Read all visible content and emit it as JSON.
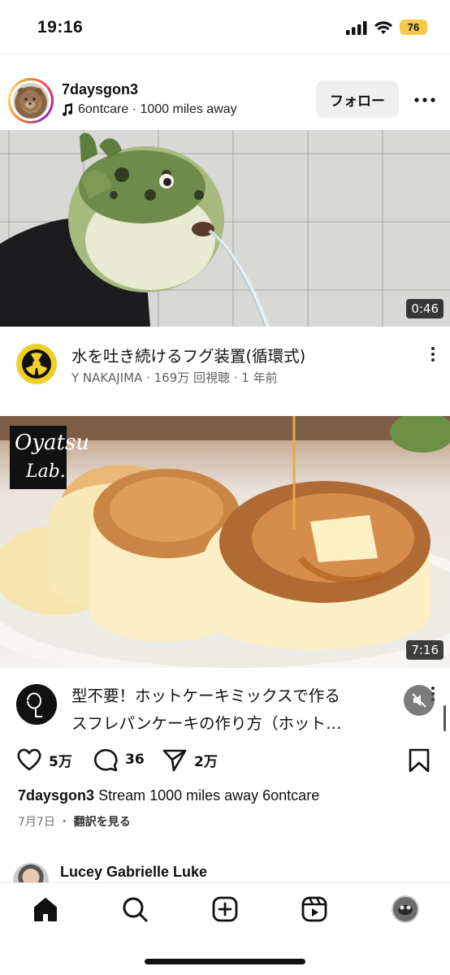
{
  "status_bar": {
    "time": "19:16",
    "battery": "76"
  },
  "post": {
    "username": "7daysgon3",
    "subtitle": "6ontcare · 1000 miles away",
    "follow_label": "フォロー",
    "more_label": "•••"
  },
  "videos": [
    {
      "duration": "0:46",
      "title": "水を吐き続けるフグ装置(循環式)",
      "meta": "Y NAKAJIMA · 169万 回視聴 · 1 年前"
    },
    {
      "duration": "7:16",
      "title_line1": "型不要！ホットケーキミックスで作る",
      "title_line2": "スフレパンケーキの作り方（ホット…",
      "logo_text_line1": "Oyatsu",
      "logo_text_line2": "Lab."
    }
  ],
  "actions": {
    "likes": "5万",
    "comments": "36",
    "shares": "2万"
  },
  "caption": {
    "username": "7daysgon3",
    "text": "Stream 1000 miles away 6ontcare"
  },
  "date_line": {
    "date": "7月7日",
    "separator": "・",
    "translate": "翻訳を見る"
  },
  "next_post": {
    "username": "Lucey Gabrielle Luke"
  },
  "colors": {
    "accent": "#111111",
    "meta_gray": "#606060",
    "follow_bg": "#efefef",
    "battery": "#f2c94c"
  },
  "icons": [
    "music-note-icon",
    "heart-icon",
    "comment-icon",
    "share-icon",
    "bookmark-icon",
    "home-icon",
    "search-icon",
    "create-icon",
    "reels-icon",
    "profile-icon",
    "mute-icon"
  ]
}
